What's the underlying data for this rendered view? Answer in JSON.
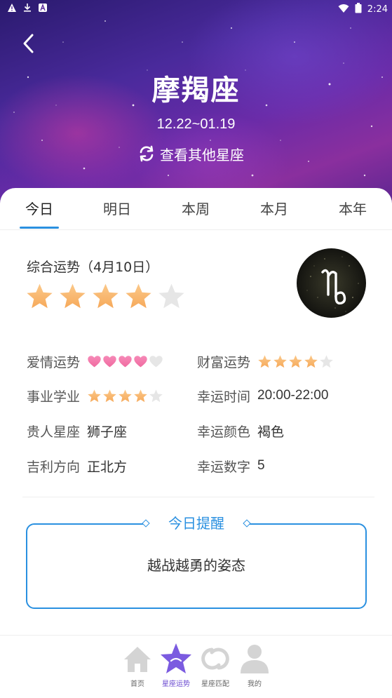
{
  "status_bar": {
    "time": "2:24"
  },
  "header": {
    "title": "摩羯座",
    "date_range": "12.22~01.19",
    "switch_label": "查看其他星座"
  },
  "tabs": [
    {
      "label": "今日",
      "active": true
    },
    {
      "label": "明日",
      "active": false
    },
    {
      "label": "本周",
      "active": false
    },
    {
      "label": "本月",
      "active": false
    },
    {
      "label": "本年",
      "active": false
    }
  ],
  "overall": {
    "label": "综合运势（4月10日）",
    "stars": 4,
    "max_stars": 5
  },
  "fortunes": {
    "love": {
      "label": "爱情运势",
      "hearts": 4,
      "max": 5
    },
    "wealth": {
      "label": "财富运势",
      "stars": 4,
      "max": 5
    },
    "career": {
      "label": "事业学业",
      "stars": 4,
      "max": 5
    },
    "lucky_time": {
      "label": "幸运时间",
      "value": "20:00-22:00"
    },
    "noble_sign": {
      "label": "贵人星座",
      "value": "狮子座"
    },
    "lucky_color": {
      "label": "幸运颜色",
      "value": "褐色"
    },
    "direction": {
      "label": "吉利方向",
      "value": "正北方"
    },
    "lucky_number": {
      "label": "幸运数字",
      "value": "5"
    }
  },
  "reminder": {
    "title": "今日提醒",
    "text": "越战越勇的姿态"
  },
  "bottom_nav": [
    {
      "label": "首页",
      "icon": "home-icon",
      "active": false
    },
    {
      "label": "星座运势",
      "icon": "star-icon",
      "active": true
    },
    {
      "label": "星座匹配",
      "icon": "match-icon",
      "active": false
    },
    {
      "label": "我的",
      "icon": "user-icon",
      "active": false
    }
  ],
  "colors": {
    "accent": "#2a90e0",
    "star_fill": "#f6a95a",
    "heart_fill": "#f06aa0",
    "empty": "#e6e6e6",
    "nav_active": "#6a4ad0"
  }
}
